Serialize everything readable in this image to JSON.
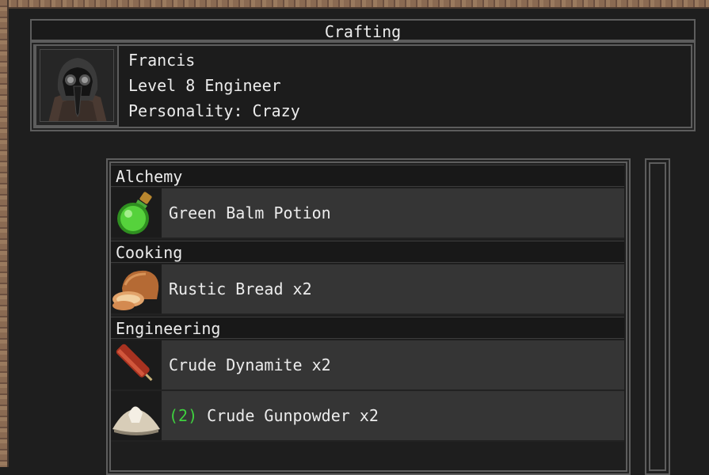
{
  "window": {
    "title": "Crafting"
  },
  "character": {
    "name": "Francis",
    "level_class": "Level 8 Engineer",
    "personality": "Personality: Crazy"
  },
  "recipe_list": {
    "categories": [
      {
        "label": "Alchemy",
        "items": [
          {
            "prefix": "",
            "name": "Green Balm Potion",
            "icon": "green-potion-icon"
          }
        ]
      },
      {
        "label": "Cooking",
        "items": [
          {
            "prefix": "",
            "name": "Rustic Bread x2",
            "icon": "bread-icon"
          }
        ]
      },
      {
        "label": "Engineering",
        "items": [
          {
            "prefix": "",
            "name": "Crude Dynamite x2",
            "icon": "dynamite-icon"
          },
          {
            "prefix": "(2)",
            "name": " Crude Gunpowder x2",
            "icon": "gunpowder-icon"
          }
        ]
      }
    ]
  },
  "colors": {
    "quantity_prefix": "#3fd13f",
    "frame": "#8a6a52",
    "panel_border": "#5d5d5d"
  }
}
